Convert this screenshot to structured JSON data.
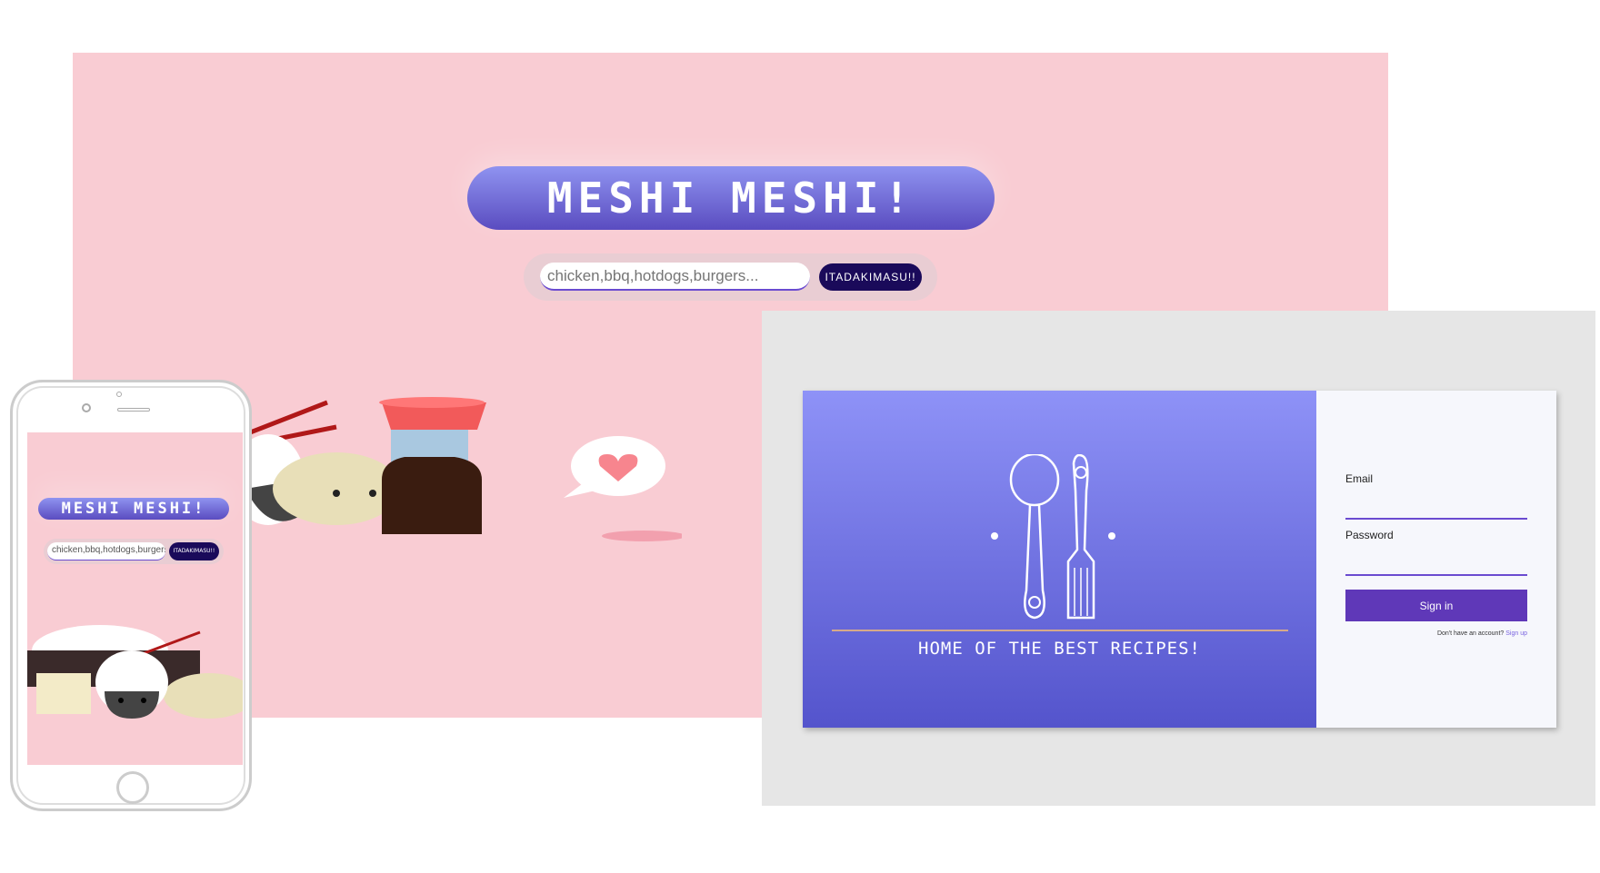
{
  "desktop": {
    "title": "MESHI MESHI!",
    "search": {
      "placeholder": "chicken,bbq,hotdogs,burgers..."
    },
    "button": "ITADAKIMASU!!"
  },
  "login": {
    "tagline": "HOME OF THE BEST RECIPES!",
    "email_label": "Email",
    "password_label": "Password",
    "sign_in": "Sign in",
    "no_account": "Don't have an account?",
    "sign_up": "Sign up"
  },
  "mobile": {
    "title": "MESHI MESHI!",
    "search": "chicken,bbq,hotdogs,burgers...",
    "button": "ITADAKIMASU!!"
  },
  "colors": {
    "pink": "#f9ccd3",
    "purple_top": "#8e92f7",
    "purple_bottom": "#5454cc",
    "button": "#5f38b8",
    "dark_button": "#1a0a5a"
  }
}
